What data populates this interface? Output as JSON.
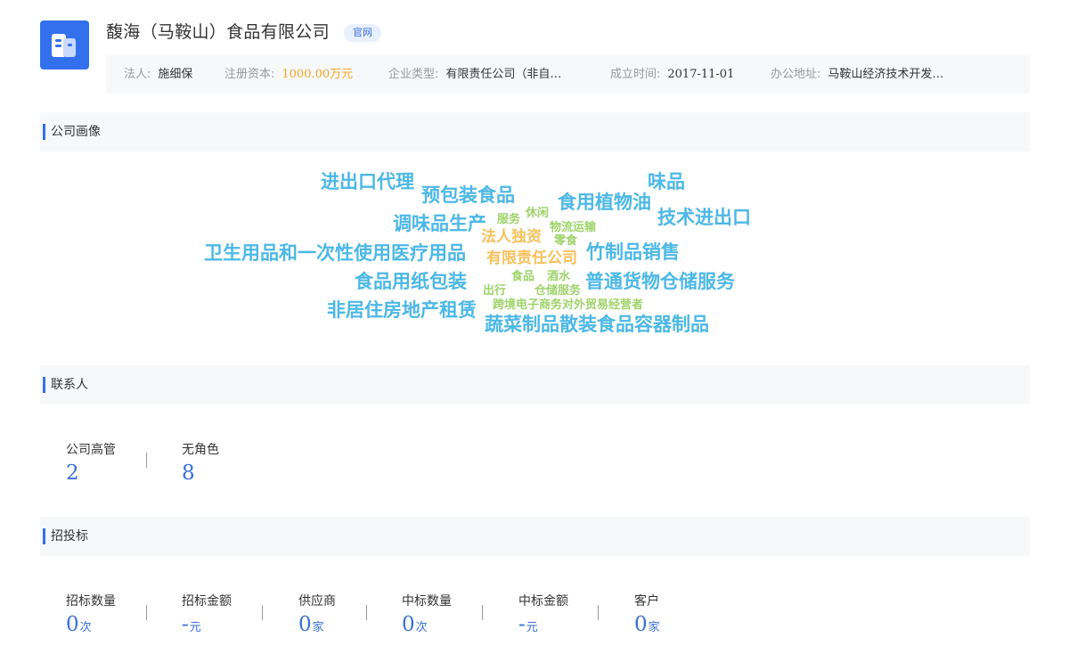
{
  "header": {
    "company_name": "馥海（马鞍山）食品有限公司",
    "badge": "官网",
    "logo_icon": "building-icon"
  },
  "info": [
    {
      "label": "法人:",
      "value": "施细保"
    },
    {
      "label": "注册资本:",
      "value": "1000.00万元"
    },
    {
      "label": "企业类型:",
      "value": "有限责任公司（非自…"
    },
    {
      "label": "成立时间:",
      "value": "2017-11-01"
    },
    {
      "label": "办公地址:",
      "value": "马鞍山经济技术开发…"
    }
  ],
  "sections": {
    "portrait": "公司画像",
    "contacts": "联系人",
    "bidding": "招投标"
  },
  "word_cloud": [
    {
      "text": "进出口代理",
      "color": "#4cb8e6"
    },
    {
      "text": "预包装食品",
      "color": "#4cb8e6"
    },
    {
      "text": "味品",
      "color": "#4cb8e6"
    },
    {
      "text": "食用植物油",
      "color": "#4cb8e6"
    },
    {
      "text": "技术进出口",
      "color": "#4cb8e6"
    },
    {
      "text": "调味品生产",
      "color": "#4cb8e6"
    },
    {
      "text": "服务",
      "color": "#9fd36a"
    },
    {
      "text": "休闲",
      "color": "#9fd36a"
    },
    {
      "text": "物流运输",
      "color": "#9fd36a"
    },
    {
      "text": "法人独资",
      "color": "#f7c15b"
    },
    {
      "text": "零食",
      "color": "#9fd36a"
    },
    {
      "text": "卫生用品和一次性使用医疗用品",
      "color": "#4cb8e6"
    },
    {
      "text": "有限责任公司",
      "color": "#f7c15b"
    },
    {
      "text": "竹制品销售",
      "color": "#4cb8e6"
    },
    {
      "text": "食品",
      "color": "#9fd36a"
    },
    {
      "text": "酒水",
      "color": "#9fd36a"
    },
    {
      "text": "食品用纸包装",
      "color": "#4cb8e6"
    },
    {
      "text": "普通货物仓储服务",
      "color": "#4cb8e6"
    },
    {
      "text": "出行",
      "color": "#9fd36a"
    },
    {
      "text": "仓储服务",
      "color": "#9fd36a"
    },
    {
      "text": "跨境电子商务对外贸易经营者",
      "color": "#9fd36a"
    },
    {
      "text": "非居住房地产租赁",
      "color": "#4cb8e6"
    },
    {
      "text": "蔬菜制品散装食品容器制品",
      "color": "#4cb8e6"
    }
  ],
  "contacts": [
    {
      "label": "公司高管",
      "value": "2"
    },
    {
      "label": "无角色",
      "value": "8"
    }
  ],
  "bidding": [
    {
      "label": "招标数量",
      "value": "0",
      "unit": "次"
    },
    {
      "label": "招标金额",
      "value": "-",
      "unit": "元"
    },
    {
      "label": "供应商",
      "value": "0",
      "unit": "家"
    },
    {
      "label": "中标数量",
      "value": "0",
      "unit": "次"
    },
    {
      "label": "中标金额",
      "value": "-",
      "unit": "元"
    },
    {
      "label": "客户",
      "value": "0",
      "unit": "家"
    }
  ]
}
